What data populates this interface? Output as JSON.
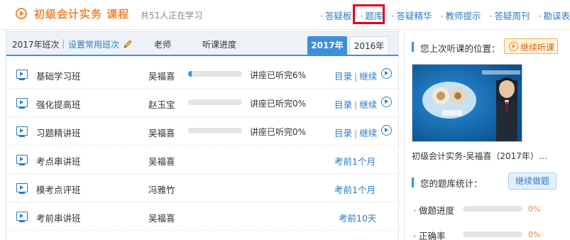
{
  "header": {
    "course_title": "初级会计实务 课程",
    "learners": "共51人正在学习",
    "nav": [
      {
        "label": "答疑板"
      },
      {
        "label": "题库"
      },
      {
        "label": "答疑精华"
      },
      {
        "label": "教师提示"
      },
      {
        "label": "答疑周刊"
      },
      {
        "label": "勘误表"
      }
    ],
    "highlight_color": "#e60012"
  },
  "table": {
    "class_label": "2017年班次",
    "set_common": "设置常用班次",
    "col_teacher": "老师",
    "col_progress": "听课进度",
    "tabs": [
      {
        "label": "2017年",
        "active": true
      },
      {
        "label": "2016年",
        "active": false
      }
    ],
    "rows": [
      {
        "name": "基础学习班",
        "teacher": "吴福喜",
        "progress": 0.06,
        "progress_text": "讲座已听完6%",
        "catalog": "目录",
        "continue": "继续",
        "note": ""
      },
      {
        "name": "强化提高班",
        "teacher": "赵玉宝",
        "progress": 0,
        "progress_text": "讲座已听完0%",
        "catalog": "目录",
        "continue": "继续",
        "note": ""
      },
      {
        "name": "习题精讲班",
        "teacher": "吴福喜",
        "progress": 0,
        "progress_text": "讲座已听完0%",
        "catalog": "目录",
        "continue": "继续",
        "note": ""
      },
      {
        "name": "考点串讲班",
        "teacher": "吴福喜",
        "progress": null,
        "progress_text": "",
        "catalog": "",
        "continue": "",
        "note": "考前1个月"
      },
      {
        "name": "模考点评班",
        "teacher": "冯雅竹",
        "progress": null,
        "progress_text": "",
        "catalog": "",
        "continue": "",
        "note": "考前1个月"
      },
      {
        "name": "考前串讲班",
        "teacher": "吴福喜",
        "progress": null,
        "progress_text": "",
        "catalog": "",
        "continue": "",
        "note": "考前10天"
      }
    ]
  },
  "side": {
    "last_position_label": "您上次听课的位置：",
    "continue_listen": "继续听课",
    "video_caption": "初级会计实务-吴福喜（2017年）…",
    "bank_stats_label": "您的题库统计：",
    "continue_practice": "继续做题",
    "stats": [
      {
        "label": "做题进度",
        "value": "0%"
      },
      {
        "label": "正确率",
        "value": "0%"
      }
    ]
  },
  "colors": {
    "accent_blue": "#3d8fdc",
    "link_blue": "#2c7bc5",
    "orange": "#f0883a"
  }
}
